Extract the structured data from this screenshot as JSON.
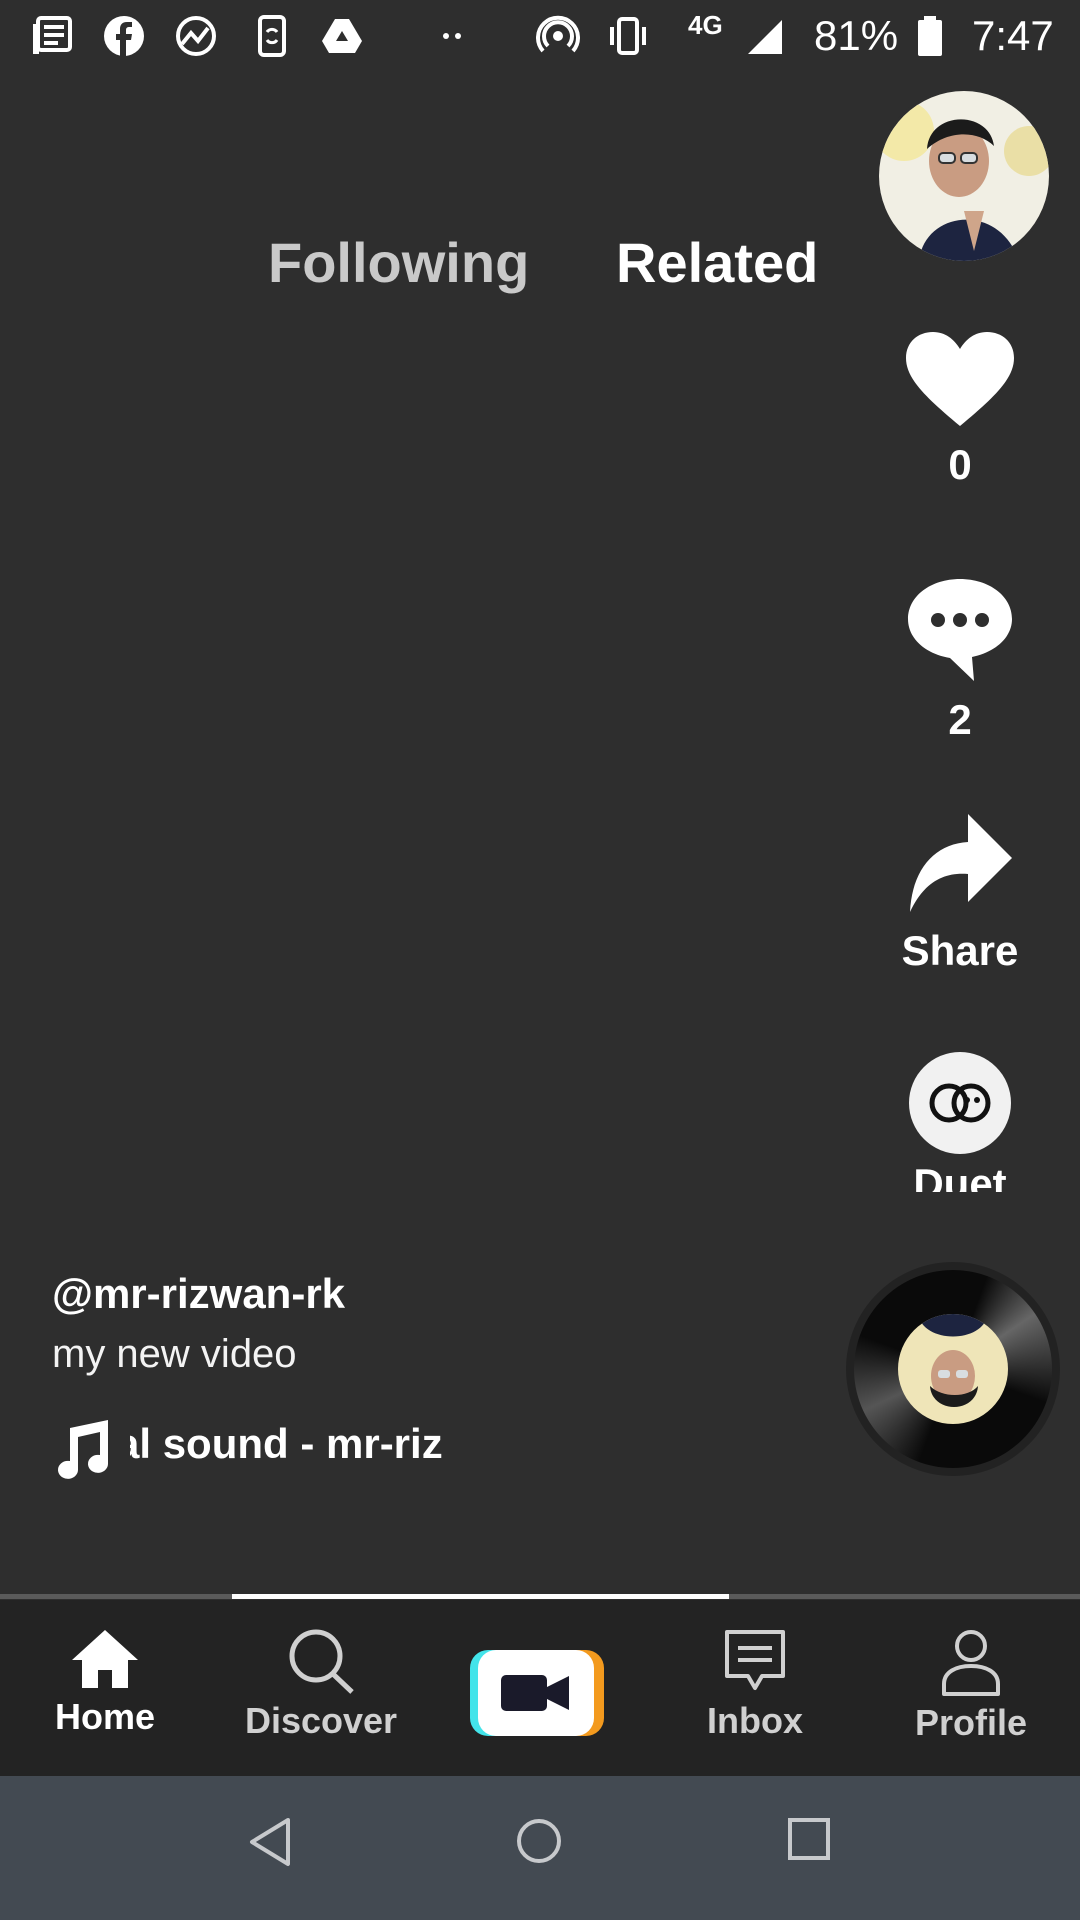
{
  "status_bar": {
    "network": "4G",
    "battery": "81%",
    "time": "7:47",
    "icons": [
      "news-icon",
      "facebook-icon",
      "analytics-icon",
      "phone-sync-icon",
      "drive-icon",
      "more-dots-icon",
      "hotspot-icon",
      "vibrate-icon",
      "signal-icon",
      "battery-icon"
    ]
  },
  "tabs": {
    "following": "Following",
    "related": "Related",
    "active": "Related"
  },
  "rail": {
    "likes": "0",
    "comments": "2",
    "share": "Share",
    "duet": "Duet"
  },
  "video": {
    "username": "@mr-rizwan-rk",
    "description": "my new video",
    "sound": "al sound - mr-riz"
  },
  "progress": {
    "fraction": 0.46
  },
  "bottom_nav": {
    "home": "Home",
    "discover": "Discover",
    "inbox": "Inbox",
    "profile": "Profile"
  },
  "colors": {
    "background": "#2e2e2e",
    "nav_background": "#232323",
    "system_nav": "#434a52",
    "create_cyan": "#43e4ea",
    "create_orange": "#f39a1e"
  }
}
